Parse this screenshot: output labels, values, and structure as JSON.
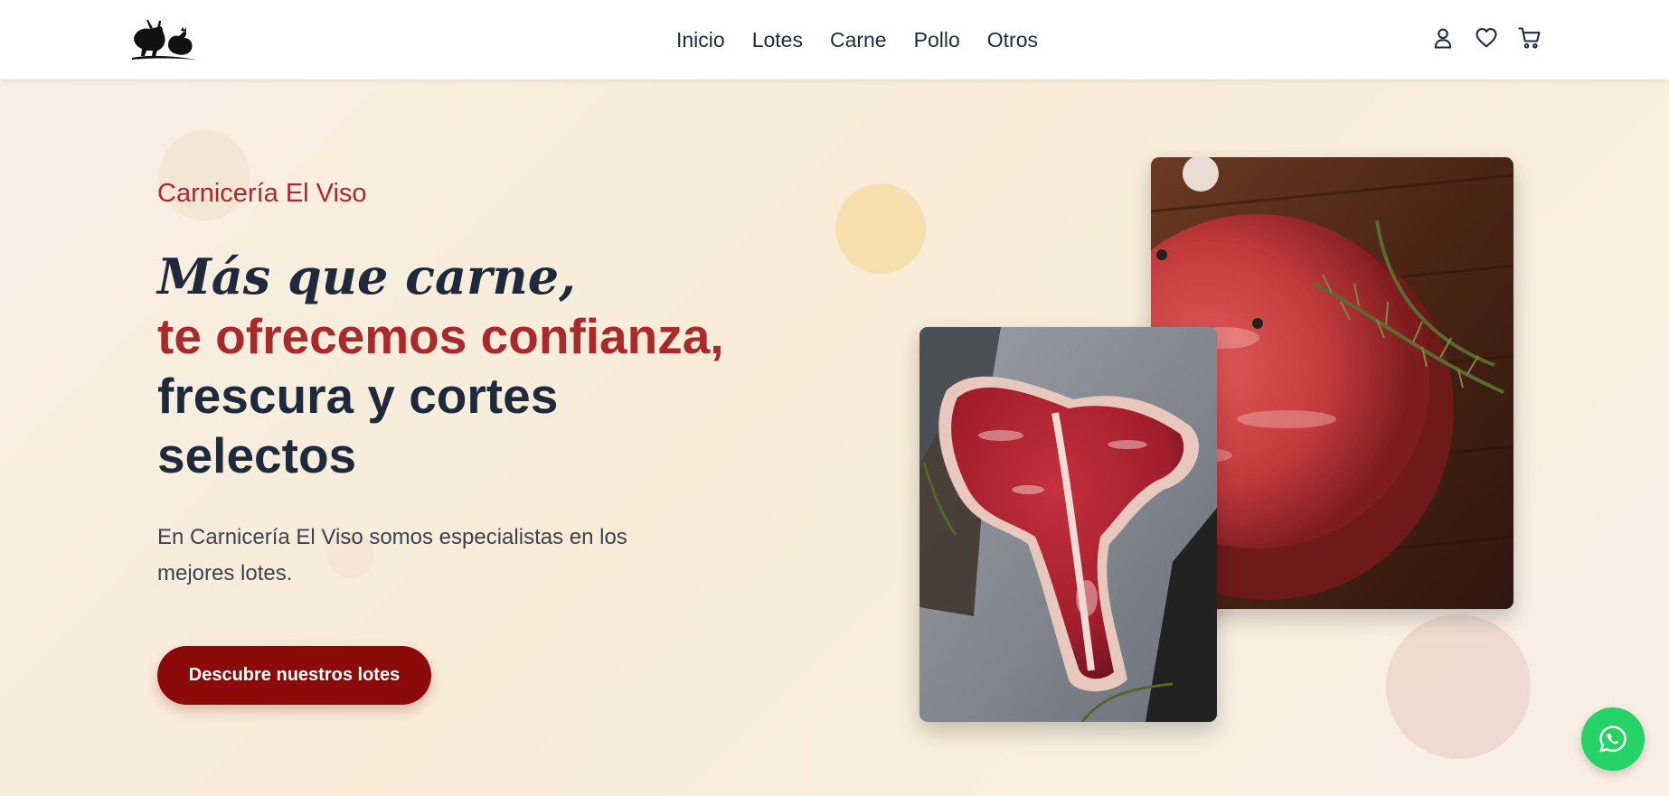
{
  "header": {
    "logo_icon": "cow-chicken-logo-icon",
    "nav": [
      {
        "label": "Inicio"
      },
      {
        "label": "Lotes"
      },
      {
        "label": "Carne"
      },
      {
        "label": "Pollo"
      },
      {
        "label": "Otros"
      }
    ],
    "icons": [
      "user-icon",
      "heart-icon",
      "cart-icon"
    ]
  },
  "hero": {
    "brand": "Carnicería El Viso",
    "headline_line1": "Más que carne,",
    "headline_line2": "te ofrecemos confianza,",
    "headline_line3": "frescura y cortes",
    "headline_line4": "selectos",
    "description": "En Carnicería El Viso somos especialistas en los mejores lotes.",
    "cta_label": "Descubre nuestros lotes",
    "images": [
      "raw-steak-rosemary-photo",
      "t-bone-steak-photo"
    ]
  },
  "floating": {
    "whatsapp_icon": "whatsapp-icon"
  },
  "colors": {
    "accent_red": "#a92a2a",
    "cta_red": "#8b0a0a",
    "heading_dark": "#1e293b",
    "whatsapp_green": "#25d366"
  }
}
